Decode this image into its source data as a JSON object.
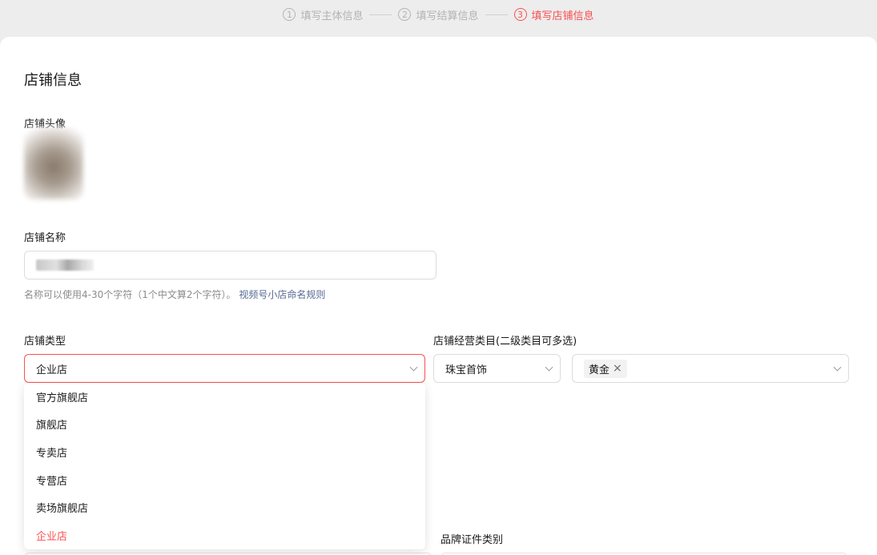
{
  "steps": [
    {
      "num": "1",
      "label": "填写主体信息"
    },
    {
      "num": "2",
      "label": "填写结算信息"
    },
    {
      "num": "3",
      "label": "填写店铺信息"
    }
  ],
  "section_title": "店铺信息",
  "avatar_label": "店铺头像",
  "name_label": "店铺名称",
  "name_hint": "名称可以使用4-30个字符（1个中文算2个字符）。",
  "name_rule_link": "视频号小店命名规则",
  "type_label": "店铺类型",
  "type_value": "企业店",
  "category_label": "店铺经营类目(二级类目可多选)",
  "category_primary": "珠宝首饰",
  "category_tags": [
    "黄金"
  ],
  "type_options": [
    "官方旗舰店",
    "旗舰店",
    "专卖店",
    "专营店",
    "卖场旗舰店",
    "企业店"
  ],
  "brand_cert_label": "品牌证件类别",
  "colors": {
    "accent": "#fa5151",
    "link": "#576b95",
    "hint": "#8c8c8c"
  },
  "icons": {
    "dropdown": "chevron-down-icon",
    "remove_tag": "close-icon"
  }
}
